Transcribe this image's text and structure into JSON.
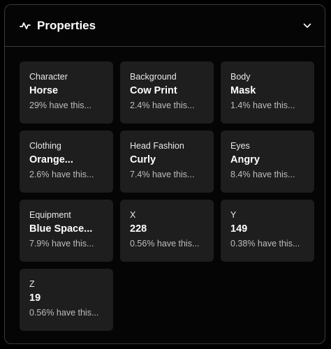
{
  "header": {
    "title": "Properties",
    "icon": "activity-icon",
    "toggle_icon": "chevron-down-icon"
  },
  "properties": [
    {
      "trait_type": "Character",
      "value": "Horse",
      "rarity": "29% have this..."
    },
    {
      "trait_type": "Background",
      "value": "Cow Print",
      "rarity": "2.4% have this..."
    },
    {
      "trait_type": "Body",
      "value": "Mask",
      "rarity": "1.4% have this..."
    },
    {
      "trait_type": "Clothing",
      "value": "Orange...",
      "rarity": "2.6% have this..."
    },
    {
      "trait_type": "Head Fashion",
      "value": "Curly",
      "rarity": "7.4% have this..."
    },
    {
      "trait_type": "Eyes",
      "value": "Angry",
      "rarity": "8.4% have this..."
    },
    {
      "trait_type": "Equipment",
      "value": "Blue Space...",
      "rarity": "7.9% have this..."
    },
    {
      "trait_type": "X",
      "value": "228",
      "rarity": "0.56% have this..."
    },
    {
      "trait_type": "Y",
      "value": "149",
      "rarity": "0.38% have this..."
    },
    {
      "trait_type": "Z",
      "value": "19",
      "rarity": "0.56% have this..."
    }
  ]
}
